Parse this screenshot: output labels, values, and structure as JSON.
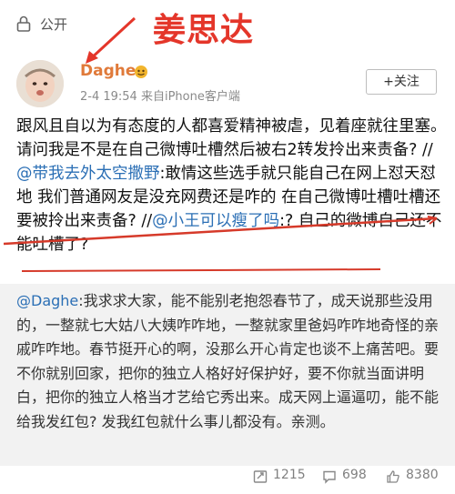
{
  "header": {
    "public_label": "公开",
    "annotation_name": "姜思达"
  },
  "author": {
    "name": "Daghe",
    "meta": "2-4 19:54  来自iPhone客户端",
    "follow_label": "+关注"
  },
  "post": {
    "part1": "跟风且自以为有态度的人都喜爱精神被虐，见着座就往里塞。请问我是不是在自己微博吐槽然后被右2转发拎出来责备? //",
    "mention1": "@带我去外太空撒野",
    "part2": ":敢情这些选手就只能自己在网上怼天怼地 我们普通网友是没充网费还是咋的 在自己微博吐槽吐槽还要被拎出来责备? //",
    "mention2": "@小王可以瘦了吗",
    "part3": ":? 自己的微博自己还不能吐槽了?"
  },
  "repost": {
    "mention": "@Daghe",
    "text": ":我求求大家，能不能别老抱怨春节了，成天说那些没用的，一整就七大姑八大姨咋咋地，一整就家里爸妈咋咋地奇怪的亲戚咋咋地。春节挺开心的啊，没那么开心肯定也谈不上痛苦吧。要不你就别回家，把你的独立人格好好保护好，要不你就当面讲明白，把你的独立人格当才艺给它秀出来。成天网上逼逼叨，能不能给我发红包? 发我红包就什么事儿都没有。亲测。"
  },
  "stats": {
    "reposts": "1215",
    "comments": "698",
    "likes": "8380"
  },
  "colors": {
    "mention": "#2b6fb5",
    "annotation": "#e4362a",
    "username": "#e07a3a"
  }
}
